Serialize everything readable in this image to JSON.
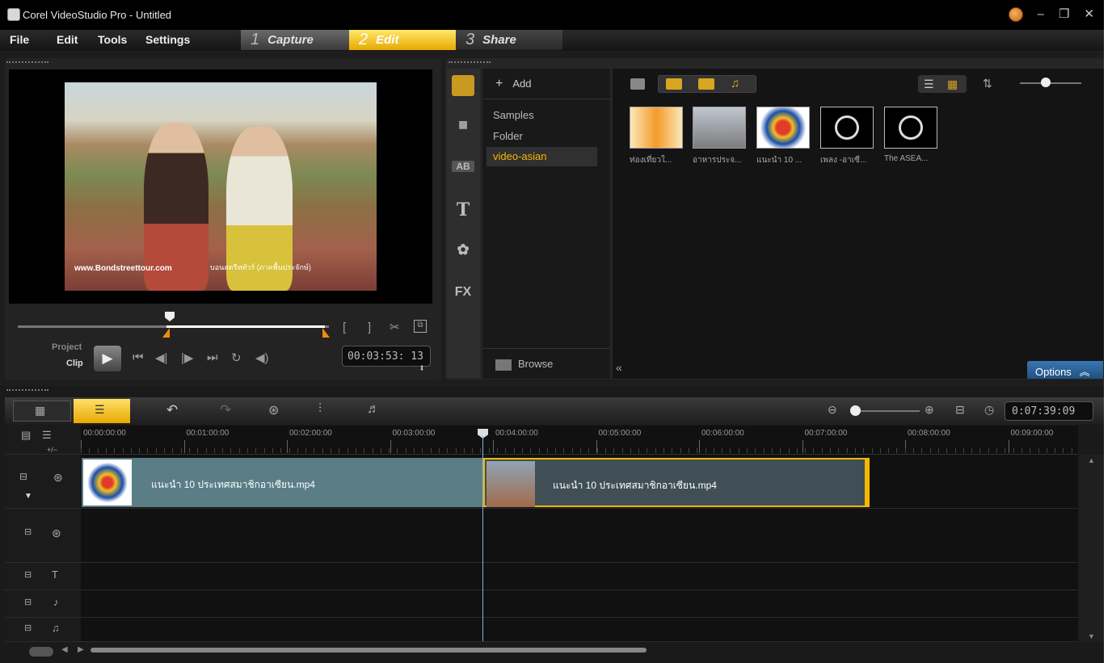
{
  "window": {
    "title": "Corel VideoStudio Pro - Untitled",
    "min": "–",
    "restore": "❐",
    "close": "✕"
  },
  "menu": {
    "file": "File",
    "edit": "Edit",
    "tools": "Tools",
    "settings": "Settings"
  },
  "steps": {
    "capture": {
      "num": "1",
      "label": "Capture"
    },
    "edit": {
      "num": "2",
      "label": "Edit"
    },
    "share": {
      "num": "3",
      "label": "Share"
    }
  },
  "player": {
    "watermark_left": "www.Bondstreettour.com",
    "watermark_right": "บอนสตรีททัวร์ (ภาคพื้นประจักษ์)",
    "mode_project": "Project",
    "mode_clip": "Clip",
    "timecode": "00:03:53: 13",
    "scrub_position": 0.49
  },
  "library": {
    "add_label": "Add",
    "folders": [
      "Samples",
      "Folder",
      "video-asian"
    ],
    "selected_folder": "video-asian",
    "browse_label": "Browse",
    "options_label": "Options",
    "sidetab_fx": "FX",
    "sidetab_ab": "AB",
    "sidetab_t": "T",
    "thumbs": [
      {
        "label": "ท่องเที่ยวใ..."
      },
      {
        "label": "อาหารประจ..."
      },
      {
        "label": "แนะนำ 10 ..."
      },
      {
        "label": "เพลง -อาเซี..."
      },
      {
        "label": "The ASEA..."
      }
    ]
  },
  "timeline": {
    "total": "0:07:39:09",
    "ruler": [
      "00:00:00:00",
      "00:01:00:00",
      "00:02:00:00",
      "00:03:00:00",
      "00:04:00:00",
      "00:05:00:00",
      "00:06:00:00",
      "00:07:00:00",
      "00:08:00:00",
      "00:09:00:00"
    ],
    "add_track_label": "+/−",
    "clips": [
      {
        "title": "แนะนำ 10 ประเทศสมาชิกอาเซียน.mp4"
      },
      {
        "title": "แนะนำ 10 ประเทศสมาชิกอาเซียน.mp4"
      }
    ],
    "accent": "#f5b800",
    "clip_color": "#5a7d86"
  }
}
